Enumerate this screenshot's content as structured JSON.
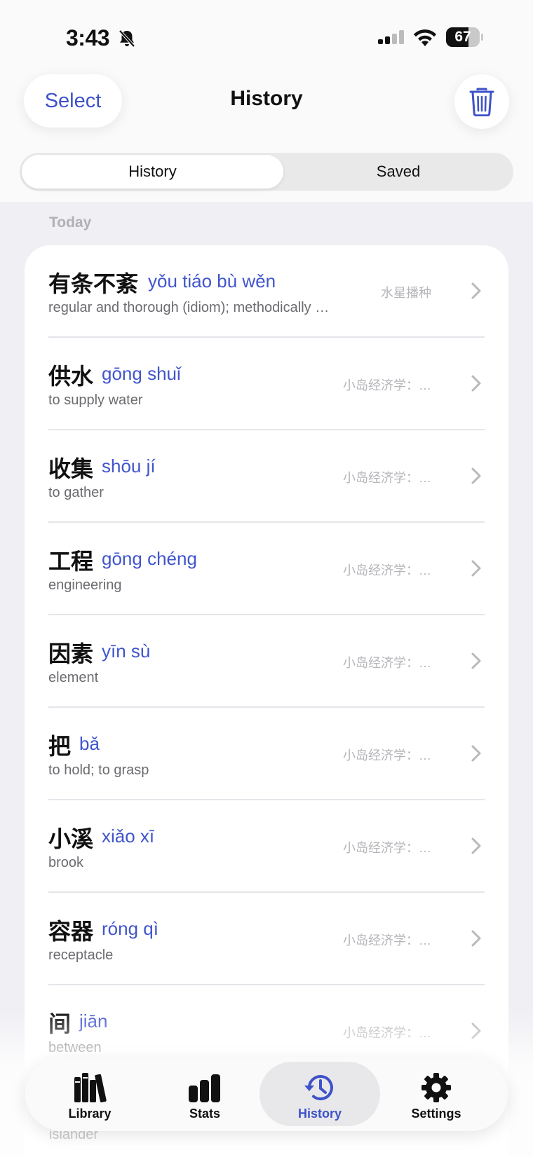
{
  "status_bar": {
    "time": "3:43",
    "battery": "67",
    "battery_level": 0.67
  },
  "header": {
    "select_label": "Select",
    "title": "History"
  },
  "segments": {
    "history": "History",
    "saved": "Saved"
  },
  "section": {
    "label": "Today"
  },
  "entries": [
    {
      "hanzi": "有条不紊",
      "pinyin": "yǒu tiáo bù wěn",
      "definition": "regular and thorough (idiom); methodically arranged",
      "source": "水星播种"
    },
    {
      "hanzi": "供水",
      "pinyin": "gōng shuǐ",
      "definition": "to supply water",
      "source": "小岛经济学：…"
    },
    {
      "hanzi": "收集",
      "pinyin": "shōu jí",
      "definition": "to gather",
      "source": "小岛经济学：…"
    },
    {
      "hanzi": "工程",
      "pinyin": "gōng chéng",
      "definition": "engineering",
      "source": "小岛经济学：…"
    },
    {
      "hanzi": "因素",
      "pinyin": "yīn sù",
      "definition": "element",
      "source": "小岛经济学：…"
    },
    {
      "hanzi": "把",
      "pinyin": "bǎ",
      "definition": "to hold; to grasp",
      "source": "小岛经济学：…"
    },
    {
      "hanzi": "小溪",
      "pinyin": "xiǎo xī",
      "definition": "brook",
      "source": "小岛经济学：…"
    },
    {
      "hanzi": "容器",
      "pinyin": "róng qì",
      "definition": "receptacle",
      "source": "小岛经济学：…"
    },
    {
      "hanzi": "间",
      "pinyin": "jiān",
      "definition": "between",
      "source": "小岛经济学：…"
    }
  ],
  "partial_entry": {
    "definition": "islander"
  },
  "tabbar": {
    "library": "Library",
    "stats": "Stats",
    "history": "History",
    "settings": "Settings"
  },
  "colors": {
    "accent": "#3d52c9",
    "pinyin": "#4055cc",
    "background": "#efeff4"
  },
  "icons": [
    "bell-slash-icon",
    "signal-icon",
    "wifi-icon",
    "battery-icon",
    "trash-icon",
    "chevron-right-icon",
    "library-icon",
    "stats-icon",
    "history-icon",
    "gear-icon"
  ]
}
